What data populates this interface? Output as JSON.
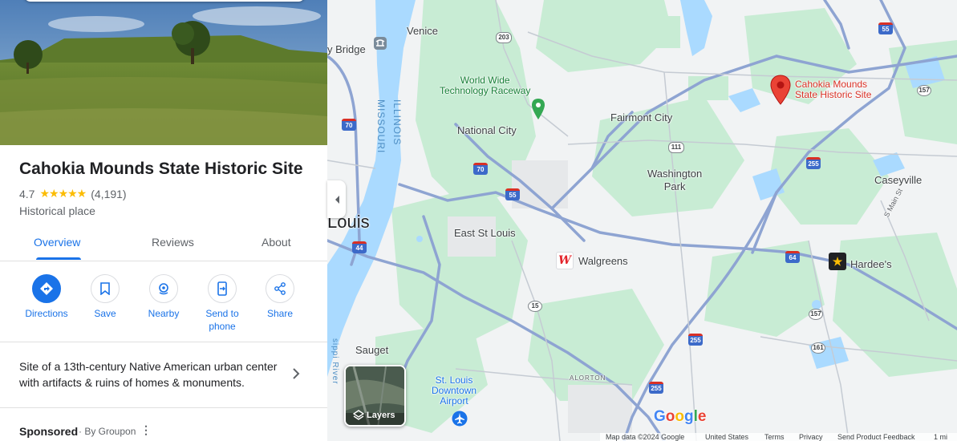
{
  "place": {
    "title": "Cahokia Mounds State Historic Site",
    "rating": "4.7",
    "stars": "★★★★★",
    "review_count": "(4,191)",
    "category": "Historical place"
  },
  "tabs": [
    {
      "label": "Overview",
      "active": true
    },
    {
      "label": "Reviews",
      "active": false
    },
    {
      "label": "About",
      "active": false
    }
  ],
  "actions": [
    {
      "label": "Directions",
      "icon": "directions-icon"
    },
    {
      "label": "Save",
      "icon": "bookmark-icon"
    },
    {
      "label": "Nearby",
      "icon": "nearby-icon"
    },
    {
      "label": "Send to phone",
      "icon": "send-to-phone-icon"
    },
    {
      "label": "Share",
      "icon": "share-icon"
    }
  ],
  "summary": "Site of a 13th-century Native American urban center with artifacts & ruins of homes & monuments.",
  "sponsored": {
    "label": "Sponsored",
    "by": "· By Groupon",
    "more": "⋮"
  },
  "map": {
    "labels": {
      "venice": "Venice",
      "bridge": "y Bridge",
      "world_wide": "World Wide",
      "raceway": "Technology Raceway",
      "national_city": "National City",
      "fairmont_city": "Fairmont City",
      "cahokia_line1": "Cahokia Mounds",
      "cahokia_line2": "State Historic Site",
      "washington": "Washington",
      "park": "Park",
      "caseyville": "Caseyville",
      "east_st_louis": "East St Louis",
      "walgreens": "Walgreens",
      "hardees": "Hardee's",
      "louis": "Louis",
      "sauget": "Sauget",
      "airport_1": "St. Louis",
      "airport_2": "Downtown",
      "airport_3": "Airport",
      "alorton": "ALORTON",
      "illinois": "ILLINOIS",
      "missouri": "MISSOURI",
      "river": "sippi River",
      "s_main": "S Main St"
    },
    "shields": {
      "r203": "203",
      "r70a": "70",
      "r70b": "70",
      "r55a": "55",
      "r55b": "55",
      "r111": "111",
      "r255a": "255",
      "r255b": "255",
      "r255c": "255",
      "r64": "64",
      "r44": "44",
      "r15": "15",
      "r157a": "157",
      "r157b": "157",
      "r161": "161"
    },
    "layers_label": "Layers",
    "google_logo": [
      "G",
      "o",
      "o",
      "g",
      "l",
      "e"
    ],
    "google_colors": [
      "#4285f4",
      "#ea4335",
      "#fbbc04",
      "#4285f4",
      "#34a853",
      "#ea4335"
    ],
    "footer": {
      "map_data": "Map data ©2024 Google",
      "country": "United States",
      "terms": "Terms",
      "privacy": "Privacy",
      "feedback": "Send Product Feedback",
      "scale": "1 mi"
    },
    "colors": {
      "water": "#aadaff",
      "park": "#c8ecd4",
      "road": "#8ea4d2",
      "pin": "#ea4335"
    }
  }
}
